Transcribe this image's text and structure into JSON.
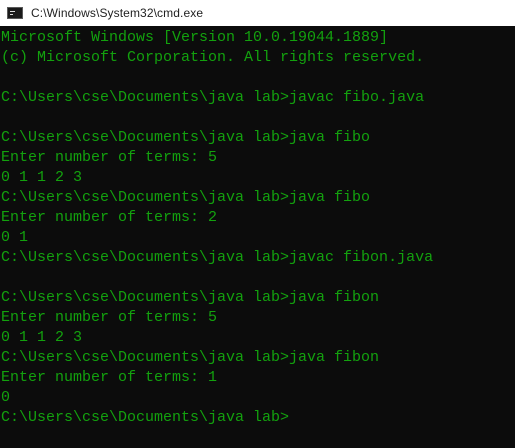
{
  "window": {
    "title": "C:\\Windows\\System32\\cmd.exe",
    "icon": "console-app-icon"
  },
  "colors": {
    "title_bar_background": "#ffffff",
    "console_background": "#0c0c0c",
    "console_text": "#13a10e"
  },
  "console": {
    "lines": [
      "Microsoft Windows [Version 10.0.19044.1889]",
      "(c) Microsoft Corporation. All rights reserved.",
      "",
      "C:\\Users\\cse\\Documents\\java lab>javac fibo.java",
      "",
      "C:\\Users\\cse\\Documents\\java lab>java fibo",
      "Enter number of terms: 5",
      "0 1 1 2 3",
      "C:\\Users\\cse\\Documents\\java lab>java fibo",
      "Enter number of terms: 2",
      "0 1",
      "C:\\Users\\cse\\Documents\\java lab>javac fibon.java",
      "",
      "C:\\Users\\cse\\Documents\\java lab>java fibon",
      "Enter number of terms: 5",
      "0 1 1 2 3",
      "C:\\Users\\cse\\Documents\\java lab>java fibon",
      "Enter number of terms: 1",
      "0",
      "C:\\Users\\cse\\Documents\\java lab>"
    ]
  }
}
